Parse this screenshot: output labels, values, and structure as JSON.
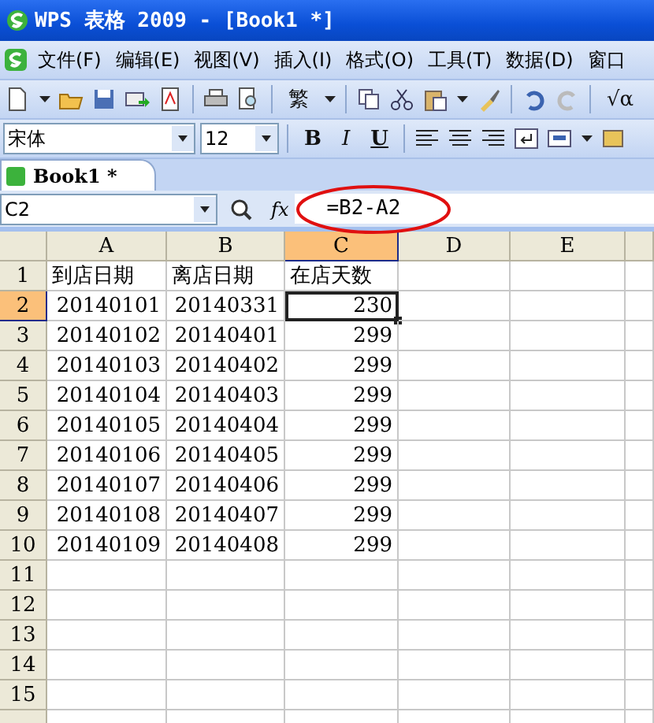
{
  "window": {
    "title": "WPS 表格 2009 - [Book1 *]"
  },
  "menu": [
    "文件(F)",
    "编辑(E)",
    "视图(V)",
    "插入(I)",
    "格式(O)",
    "工具(T)",
    "数据(D)",
    "窗口"
  ],
  "toolbar": {
    "traditional": "繁",
    "equation": "√α"
  },
  "format_toolbar": {
    "font": "宋体",
    "size": "12",
    "bold": "B",
    "italic": "I",
    "underline": "U"
  },
  "tabs": [
    {
      "label": "Book1 *",
      "selected": true
    }
  ],
  "formula_bar": {
    "name_box": "C2",
    "function_label": "fx",
    "formula": "=B2-A2",
    "highlighted": true
  },
  "columns": [
    {
      "label": "A",
      "selected": false
    },
    {
      "label": "B",
      "selected": false
    },
    {
      "label": "C",
      "selected": true
    },
    {
      "label": "D",
      "selected": false
    },
    {
      "label": "E",
      "selected": false
    }
  ],
  "rows": [
    {
      "label": "1",
      "selected": false,
      "cells": [
        {
          "text": "到店日期",
          "selected": false
        },
        {
          "text": "离店日期",
          "selected": false
        },
        {
          "text": "在店天数",
          "selected": false
        }
      ]
    },
    {
      "label": "2",
      "selected": true,
      "cells": [
        {
          "text": "20140101",
          "selected": false
        },
        {
          "text": "20140331",
          "selected": false
        },
        {
          "text": "230",
          "selected": true
        }
      ]
    },
    {
      "label": "3",
      "selected": false,
      "cells": [
        {
          "text": "20140102",
          "selected": false
        },
        {
          "text": "20140401",
          "selected": false
        },
        {
          "text": "299",
          "selected": false
        }
      ]
    },
    {
      "label": "4",
      "selected": false,
      "cells": [
        {
          "text": "20140103",
          "selected": false
        },
        {
          "text": "20140402",
          "selected": false
        },
        {
          "text": "299",
          "selected": false
        }
      ]
    },
    {
      "label": "5",
      "selected": false,
      "cells": [
        {
          "text": "20140104",
          "selected": false
        },
        {
          "text": "20140403",
          "selected": false
        },
        {
          "text": "299",
          "selected": false
        }
      ]
    },
    {
      "label": "6",
      "selected": false,
      "cells": [
        {
          "text": "20140105",
          "selected": false
        },
        {
          "text": "20140404",
          "selected": false
        },
        {
          "text": "299",
          "selected": false
        }
      ]
    },
    {
      "label": "7",
      "selected": false,
      "cells": [
        {
          "text": "20140106",
          "selected": false
        },
        {
          "text": "20140405",
          "selected": false
        },
        {
          "text": "299",
          "selected": false
        }
      ]
    },
    {
      "label": "8",
      "selected": false,
      "cells": [
        {
          "text": "20140107",
          "selected": false
        },
        {
          "text": "20140406",
          "selected": false
        },
        {
          "text": "299",
          "selected": false
        }
      ]
    },
    {
      "label": "9",
      "selected": false,
      "cells": [
        {
          "text": "20140108",
          "selected": false
        },
        {
          "text": "20140407",
          "selected": false
        },
        {
          "text": "299",
          "selected": false
        }
      ]
    },
    {
      "label": "10",
      "selected": false,
      "cells": [
        {
          "text": "20140109",
          "selected": false
        },
        {
          "text": "20140408",
          "selected": false
        },
        {
          "text": "299",
          "selected": false
        }
      ]
    },
    {
      "label": "11",
      "selected": false,
      "cells": []
    },
    {
      "label": "12",
      "selected": false,
      "cells": []
    },
    {
      "label": "13",
      "selected": false,
      "cells": []
    },
    {
      "label": "14",
      "selected": false,
      "cells": []
    },
    {
      "label": "15",
      "selected": false,
      "cells": []
    }
  ]
}
